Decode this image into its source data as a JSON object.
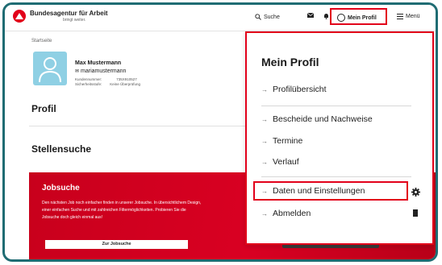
{
  "header": {
    "agency": "Bundesagentur für Arbeit",
    "slogan": "bringt weiter.",
    "search": "Suche",
    "profile": "Mein Profil",
    "menu": "Menü"
  },
  "breadcrumb": "Startseite",
  "user": {
    "name": "Max Mustermann",
    "email": "mariamustermann",
    "customer_label": "Kundennummer:",
    "customer_value": "735X910527",
    "security_label": "Sicherheitsstufe:",
    "security_value": "Keine Überprüfung"
  },
  "sections": {
    "profil": "Profil",
    "stellensuche": "Stellensuche"
  },
  "banner": {
    "title": "Jobsuche",
    "text": "Den nächsten Job noch einfacher finden in unserer Jobsuche. In übersichtlichem Design, einer einfachen Suche und mit zahlreichen Filtermöglichkeiten. Probieren Sie die Jobsuche doch gleich einmal aus!",
    "button": "Zur Jobsuche"
  },
  "dropdown": {
    "title": "Mein Profil",
    "items": [
      "Profilübersicht",
      "Bescheide und Nachweise",
      "Termine",
      "Verlauf",
      "Daten und Einstellungen",
      "Abmelden"
    ]
  },
  "colors": {
    "brand_red": "#e2001a",
    "frame_teal": "#1f6c73",
    "avatar_blue": "#8fd0e4"
  }
}
